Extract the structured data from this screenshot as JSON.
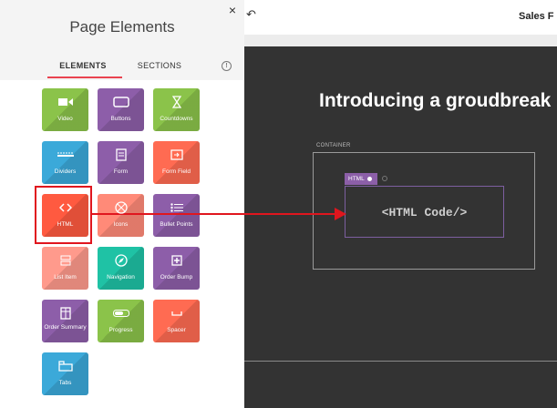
{
  "panel": {
    "title": "Page Elements",
    "close_label": "×",
    "tabs": [
      {
        "label": "ELEMENTS",
        "active": true
      },
      {
        "label": "SECTIONS",
        "active": false
      }
    ],
    "info_label": "!"
  },
  "tiles": [
    {
      "label": "Video",
      "color": "#8bc34a",
      "icon": "video-icon"
    },
    {
      "label": "Buttons",
      "color": "#8d5ea9",
      "icon": "buttons-icon"
    },
    {
      "label": "Countdowns",
      "color": "#8bc34a",
      "icon": "hourglass-icon"
    },
    {
      "label": "Dividers",
      "color": "#3ba9d9",
      "icon": "dividers-icon"
    },
    {
      "label": "Form",
      "color": "#8d5ea9",
      "icon": "form-icon"
    },
    {
      "label": "Form Field",
      "color": "#ff6b52",
      "icon": "form-field-icon"
    },
    {
      "label": "HTML",
      "color": "#ff5a40",
      "icon": "code-icon"
    },
    {
      "label": "Icons",
      "color": "#ff8a78",
      "icon": "icons-icon"
    },
    {
      "label": "Bullet Points",
      "color": "#8d5ea9",
      "icon": "bullet-list-icon"
    },
    {
      "label": "List Item",
      "color": "#ff9a8c",
      "icon": "list-item-icon"
    },
    {
      "label": "Navigation",
      "color": "#1fc2a5",
      "icon": "navigation-icon"
    },
    {
      "label": "Order Bump",
      "color": "#8d5ea9",
      "icon": "order-bump-icon"
    },
    {
      "label": "Order Summary",
      "color": "#8d5ea9",
      "icon": "order-summary-icon"
    },
    {
      "label": "Progress",
      "color": "#8bc34a",
      "icon": "progress-icon"
    },
    {
      "label": "Spacer",
      "color": "#ff6b52",
      "icon": "spacer-icon"
    },
    {
      "label": "Tabs",
      "color": "#3ba9d9",
      "icon": "tabs-icon"
    }
  ],
  "editor": {
    "page_title": "Sales F",
    "undo_label": "↶",
    "headline": "Introducing a groudbreak",
    "container_label": "CONTAINER",
    "html_tag_label": "HTML",
    "html_code_text": "<HTML Code/>"
  }
}
